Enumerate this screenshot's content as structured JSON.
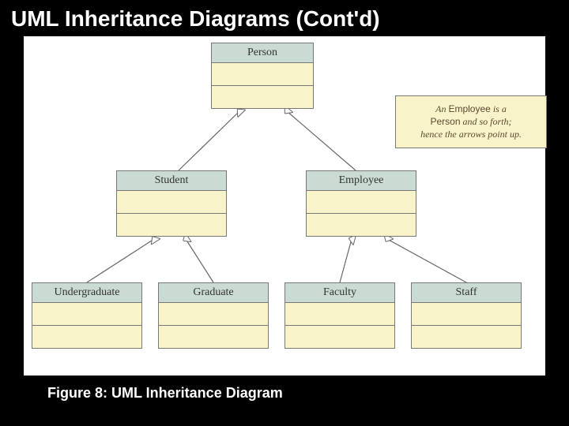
{
  "title": "UML Inheritance Diagrams (Cont'd)",
  "caption": "Figure 8: UML Inheritance Diagram",
  "classes": {
    "person": {
      "name": "Person"
    },
    "student": {
      "name": "Student"
    },
    "employee": {
      "name": "Employee"
    },
    "undergraduate": {
      "name": "Undergraduate"
    },
    "graduate": {
      "name": "Graduate"
    },
    "faculty": {
      "name": "Faculty"
    },
    "staff": {
      "name": "Staff"
    }
  },
  "note": {
    "line1_prefix": "An ",
    "line1_kw": "Employee",
    "line1_suffix": " is a",
    "line2_kw": "Person",
    "line2_suffix": " and so forth;",
    "line3": "hence the arrows point up."
  }
}
